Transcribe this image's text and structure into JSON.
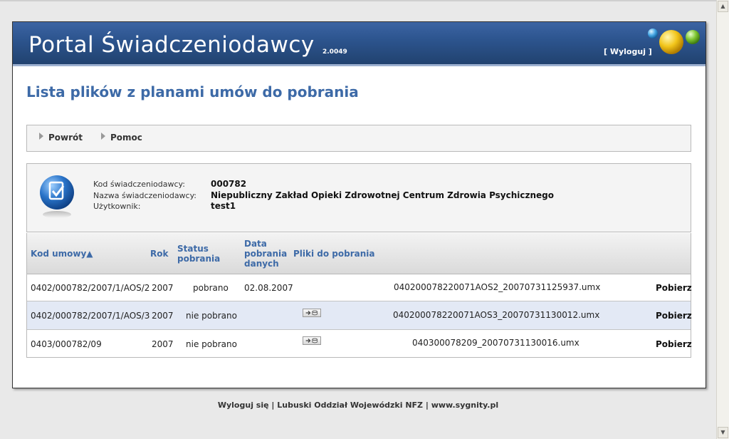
{
  "header": {
    "title": "Portal Świadczeniodawcy",
    "version": "2.0049",
    "logout": "[ Wyloguj ]"
  },
  "page_title": "Lista plików z planami umów do pobrania",
  "toolbar": {
    "back": "Powrót",
    "help": "Pomoc"
  },
  "info": {
    "code_label": "Kod świadczeniodawcy:",
    "code_value": "000782",
    "name_label": "Nazwa świadczeniodawcy:",
    "name_value": "Niepubliczny Zakład Opieki Zdrowotnej Centrum Zdrowia Psychicznego",
    "user_label": "Użytkownik:",
    "user_value": "test1"
  },
  "table": {
    "headers": {
      "contract": "Kod umowy▲",
      "year": "Rok",
      "status_1": "Status",
      "status_2": "pobrania",
      "date_1": "Data",
      "date_2": "pobrania",
      "date_3": "danych",
      "files": "Pliki do pobrania"
    },
    "rows": [
      {
        "contract": "0402/000782/2007/1/AOS/2",
        "year": "2007",
        "status": "pobrano",
        "date": "02.08.2007",
        "file": "040200078220071AOS2_20070731125937.umx",
        "action": "Pobierz"
      },
      {
        "contract": "0402/000782/2007/1/AOS/3",
        "year": "2007",
        "status": "nie pobrano",
        "date": "",
        "file": "040200078220071AOS3_20070731130012.umx",
        "action": "Pobierz"
      },
      {
        "contract": "0403/000782/09",
        "year": "2007",
        "status": "nie pobrano",
        "date": "",
        "file": "040300078209_20070731130016.umx",
        "action": "Pobierz"
      }
    ]
  },
  "footer": {
    "logout": "Wyloguj się",
    "sep1": " | ",
    "branch": "Lubuski Oddział Wojewódzki NFZ",
    "sep2": " | ",
    "site": "www.sygnity.pl"
  },
  "colors": {
    "header_blue": "#2d558f",
    "heading_blue": "#3d6aa7",
    "alt_row": "#e3e9f5"
  }
}
